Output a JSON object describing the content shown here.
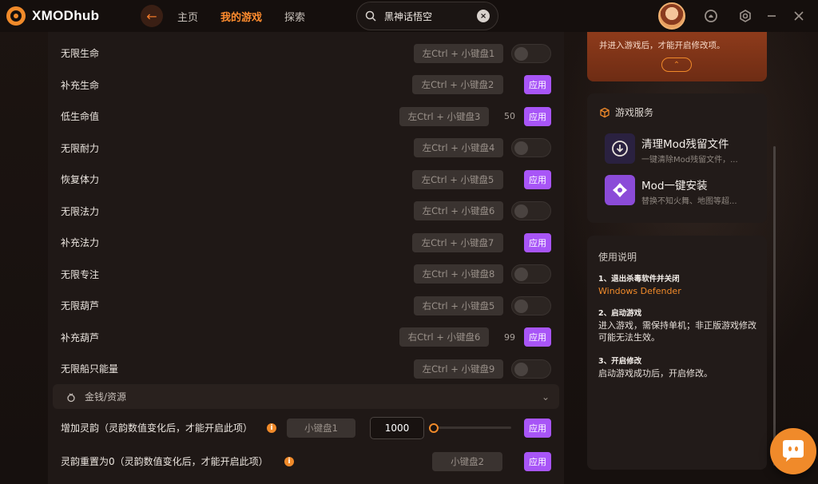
{
  "app": {
    "brand": "XMODhub"
  },
  "nav": {
    "back_icon": "arrow-left-icon",
    "items": [
      "主页",
      "我的游戏",
      "探索"
    ],
    "active": "我的游戏"
  },
  "search": {
    "value": "黑神话悟空"
  },
  "cheats": [
    {
      "label": "无限生命",
      "hotkey": "左Ctrl + 小键盘1",
      "control": "toggle",
      "on": false
    },
    {
      "label": "补充生命",
      "hotkey": "左Ctrl + 小键盘2",
      "control": "apply"
    },
    {
      "label": "低生命值",
      "hotkey": "左Ctrl + 小键盘3",
      "value": "50",
      "control": "apply"
    },
    {
      "label": "无限耐力",
      "hotkey": "左Ctrl + 小键盘4",
      "control": "toggle",
      "on": false
    },
    {
      "label": "恢复体力",
      "hotkey": "左Ctrl + 小键盘5",
      "control": "apply"
    },
    {
      "label": "无限法力",
      "hotkey": "左Ctrl + 小键盘6",
      "control": "toggle",
      "on": false
    },
    {
      "label": "补充法力",
      "hotkey": "左Ctrl + 小键盘7",
      "control": "apply"
    },
    {
      "label": "无限专注",
      "hotkey": "左Ctrl + 小键盘8",
      "control": "toggle",
      "on": false
    },
    {
      "label": "无限葫芦",
      "hotkey": "右Ctrl + 小键盘5",
      "control": "toggle",
      "on": false
    },
    {
      "label": "补充葫芦",
      "hotkey": "右Ctrl + 小键盘6",
      "value": "99",
      "control": "apply"
    },
    {
      "label": "无限船只能量",
      "hotkey": "左Ctrl + 小键盘9",
      "control": "toggle",
      "on": false
    }
  ],
  "apply_label": "应用",
  "section": {
    "title": "金钱/资源"
  },
  "money_rows": [
    {
      "label": "增加灵韵（灵韵数值变化后，才能开启此项）",
      "hotkey": "小键盘1",
      "input_value": "1000",
      "slider_level": 0
    },
    {
      "label": "灵韵重置为0（灵韵数值变化后，才能开启此项）",
      "hotkey": "小键盘2"
    }
  ],
  "promo": {
    "text": "并进入游戏后，才能开启修改项。"
  },
  "services": {
    "title": "游戏服务",
    "items": [
      {
        "name": "清理Mod残留文件",
        "desc": "一键清除Mod残留文件，...",
        "color": "#2a2140"
      },
      {
        "name": "Mod一键安装",
        "desc": "替换不知火舞、地图等超...",
        "color": "#8b4bd8"
      }
    ]
  },
  "guide": {
    "title": "使用说明",
    "steps": [
      {
        "head": "1、退出杀毒软件并关闭",
        "link": "Windows Defender"
      },
      {
        "head": "2、启动游戏",
        "body": "进入游戏，需保持单机；非正版游戏修改可能无法生效。"
      },
      {
        "head": "3、开启修改",
        "body": "启动游戏成功后，开启修改。"
      }
    ]
  },
  "colors": {
    "accent": "#f08a2a",
    "apply": "#a855f7",
    "promo": "#8e3b1b"
  }
}
